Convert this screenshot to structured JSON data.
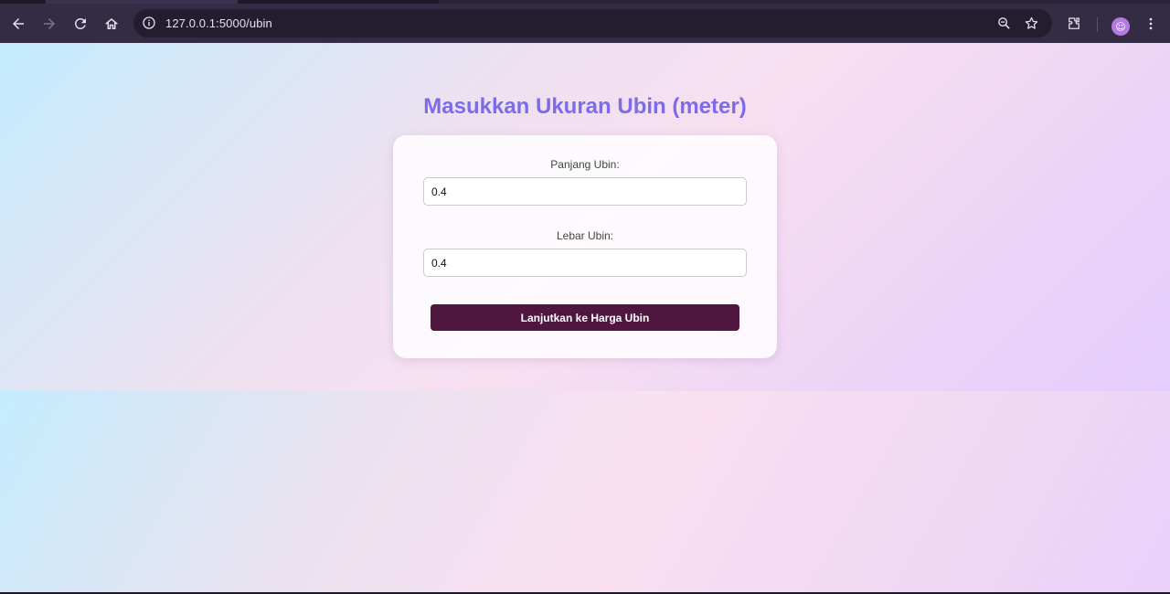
{
  "browser": {
    "url": "127.0.0.1:5000/ubin",
    "icons": {
      "back": "arrow-left-icon",
      "forward": "arrow-right-icon",
      "reload": "reload-icon",
      "home": "home-icon",
      "site_info": "info-icon",
      "zoom": "zoom-icon",
      "bookmark": "star-icon",
      "extensions": "puzzle-icon",
      "menu": "kebab-menu-icon"
    },
    "colors": {
      "toolbar": "#342c44",
      "omnibox": "#231d2f"
    }
  },
  "page": {
    "title": "Masukkan Ukuran Ubin (meter)",
    "form": {
      "length_label": "Panjang Ubin:",
      "length_value": "0.4",
      "width_label": "Lebar Ubin:",
      "width_value": "0.4",
      "submit_label": "Lanjutkan ke Harga Ubin"
    },
    "colors": {
      "title": "#7d6ce8",
      "button": "#4f1640",
      "background_start": "#c3ecfe",
      "background_end": "#e5cdfd"
    }
  }
}
